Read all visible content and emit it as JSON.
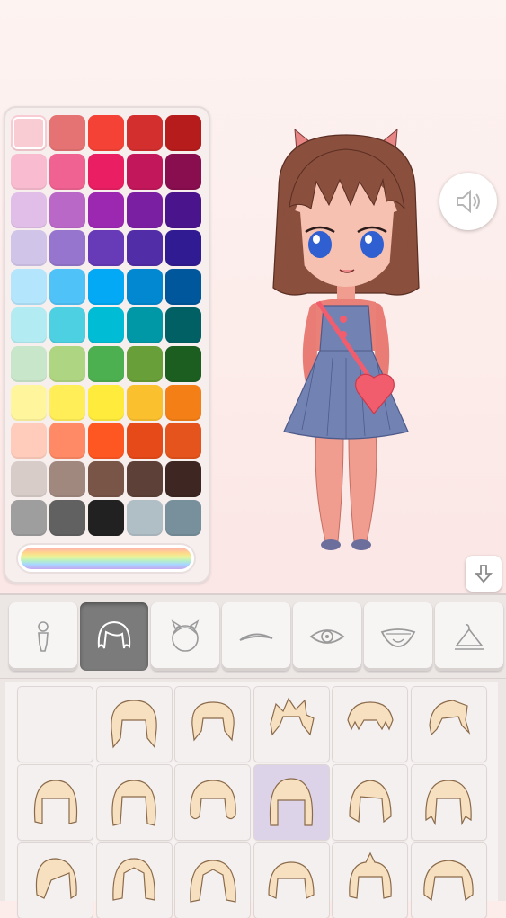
{
  "palette": {
    "colors": [
      "#f8ccd2",
      "#e57373",
      "#f44336",
      "#d32f2f",
      "#b71c1c",
      "#f8bbd0",
      "#f06292",
      "#e91e63",
      "#c2185b",
      "#880e4f",
      "#e1bee7",
      "#ba68c8",
      "#9c27b0",
      "#7b1fa2",
      "#4a148c",
      "#d1c4e9",
      "#9575cd",
      "#673ab7",
      "#512da8",
      "#311b92",
      "#b3e5fc",
      "#4fc3f7",
      "#03a9f4",
      "#0288d1",
      "#01579b",
      "#b2ebf2",
      "#4dd0e1",
      "#00bcd4",
      "#0097a7",
      "#006064",
      "#c8e6c9",
      "#aed581",
      "#4caf50",
      "#689f38",
      "#1b5e20",
      "#fff59d",
      "#ffee58",
      "#ffeb3b",
      "#fbc02d",
      "#f57f17",
      "#ffccbc",
      "#ff8a65",
      "#ff5722",
      "#e64a19",
      "#e4541c",
      "#d7ccc8",
      "#a1887f",
      "#795548",
      "#5d4037",
      "#3e2723",
      "#9e9e9e",
      "#616161",
      "#212121",
      "#b0bec5",
      "#78909c"
    ],
    "selected_index": 0
  },
  "tabs": [
    {
      "icon": "body-icon"
    },
    {
      "icon": "hair-icon",
      "active": true
    },
    {
      "icon": "head-accessory-icon"
    },
    {
      "icon": "eyebrow-icon"
    },
    {
      "icon": "eye-icon"
    },
    {
      "icon": "mouth-icon"
    },
    {
      "icon": "hanger-icon"
    }
  ],
  "hair_items": [
    {
      "style": "none"
    },
    {
      "style": "bob"
    },
    {
      "style": "bob-short"
    },
    {
      "style": "spiky"
    },
    {
      "style": "messy"
    },
    {
      "style": "swept"
    },
    {
      "style": "bangs-flat"
    },
    {
      "style": "long-wavy"
    },
    {
      "style": "bob-curl"
    },
    {
      "style": "hime",
      "selected": true
    },
    {
      "style": "layered"
    },
    {
      "style": "shaggy"
    },
    {
      "style": "side-swept"
    },
    {
      "style": "center-part"
    },
    {
      "style": "center-part-wide"
    },
    {
      "style": "mushroom"
    },
    {
      "style": "tuft"
    },
    {
      "style": "fluffy"
    }
  ],
  "colors": {
    "accent_selected_item": "#ddd3e8",
    "active_tab": "#7b7b7b"
  },
  "icons": {
    "sound": "speaker-icon",
    "download": "arrow-down-icon"
  }
}
